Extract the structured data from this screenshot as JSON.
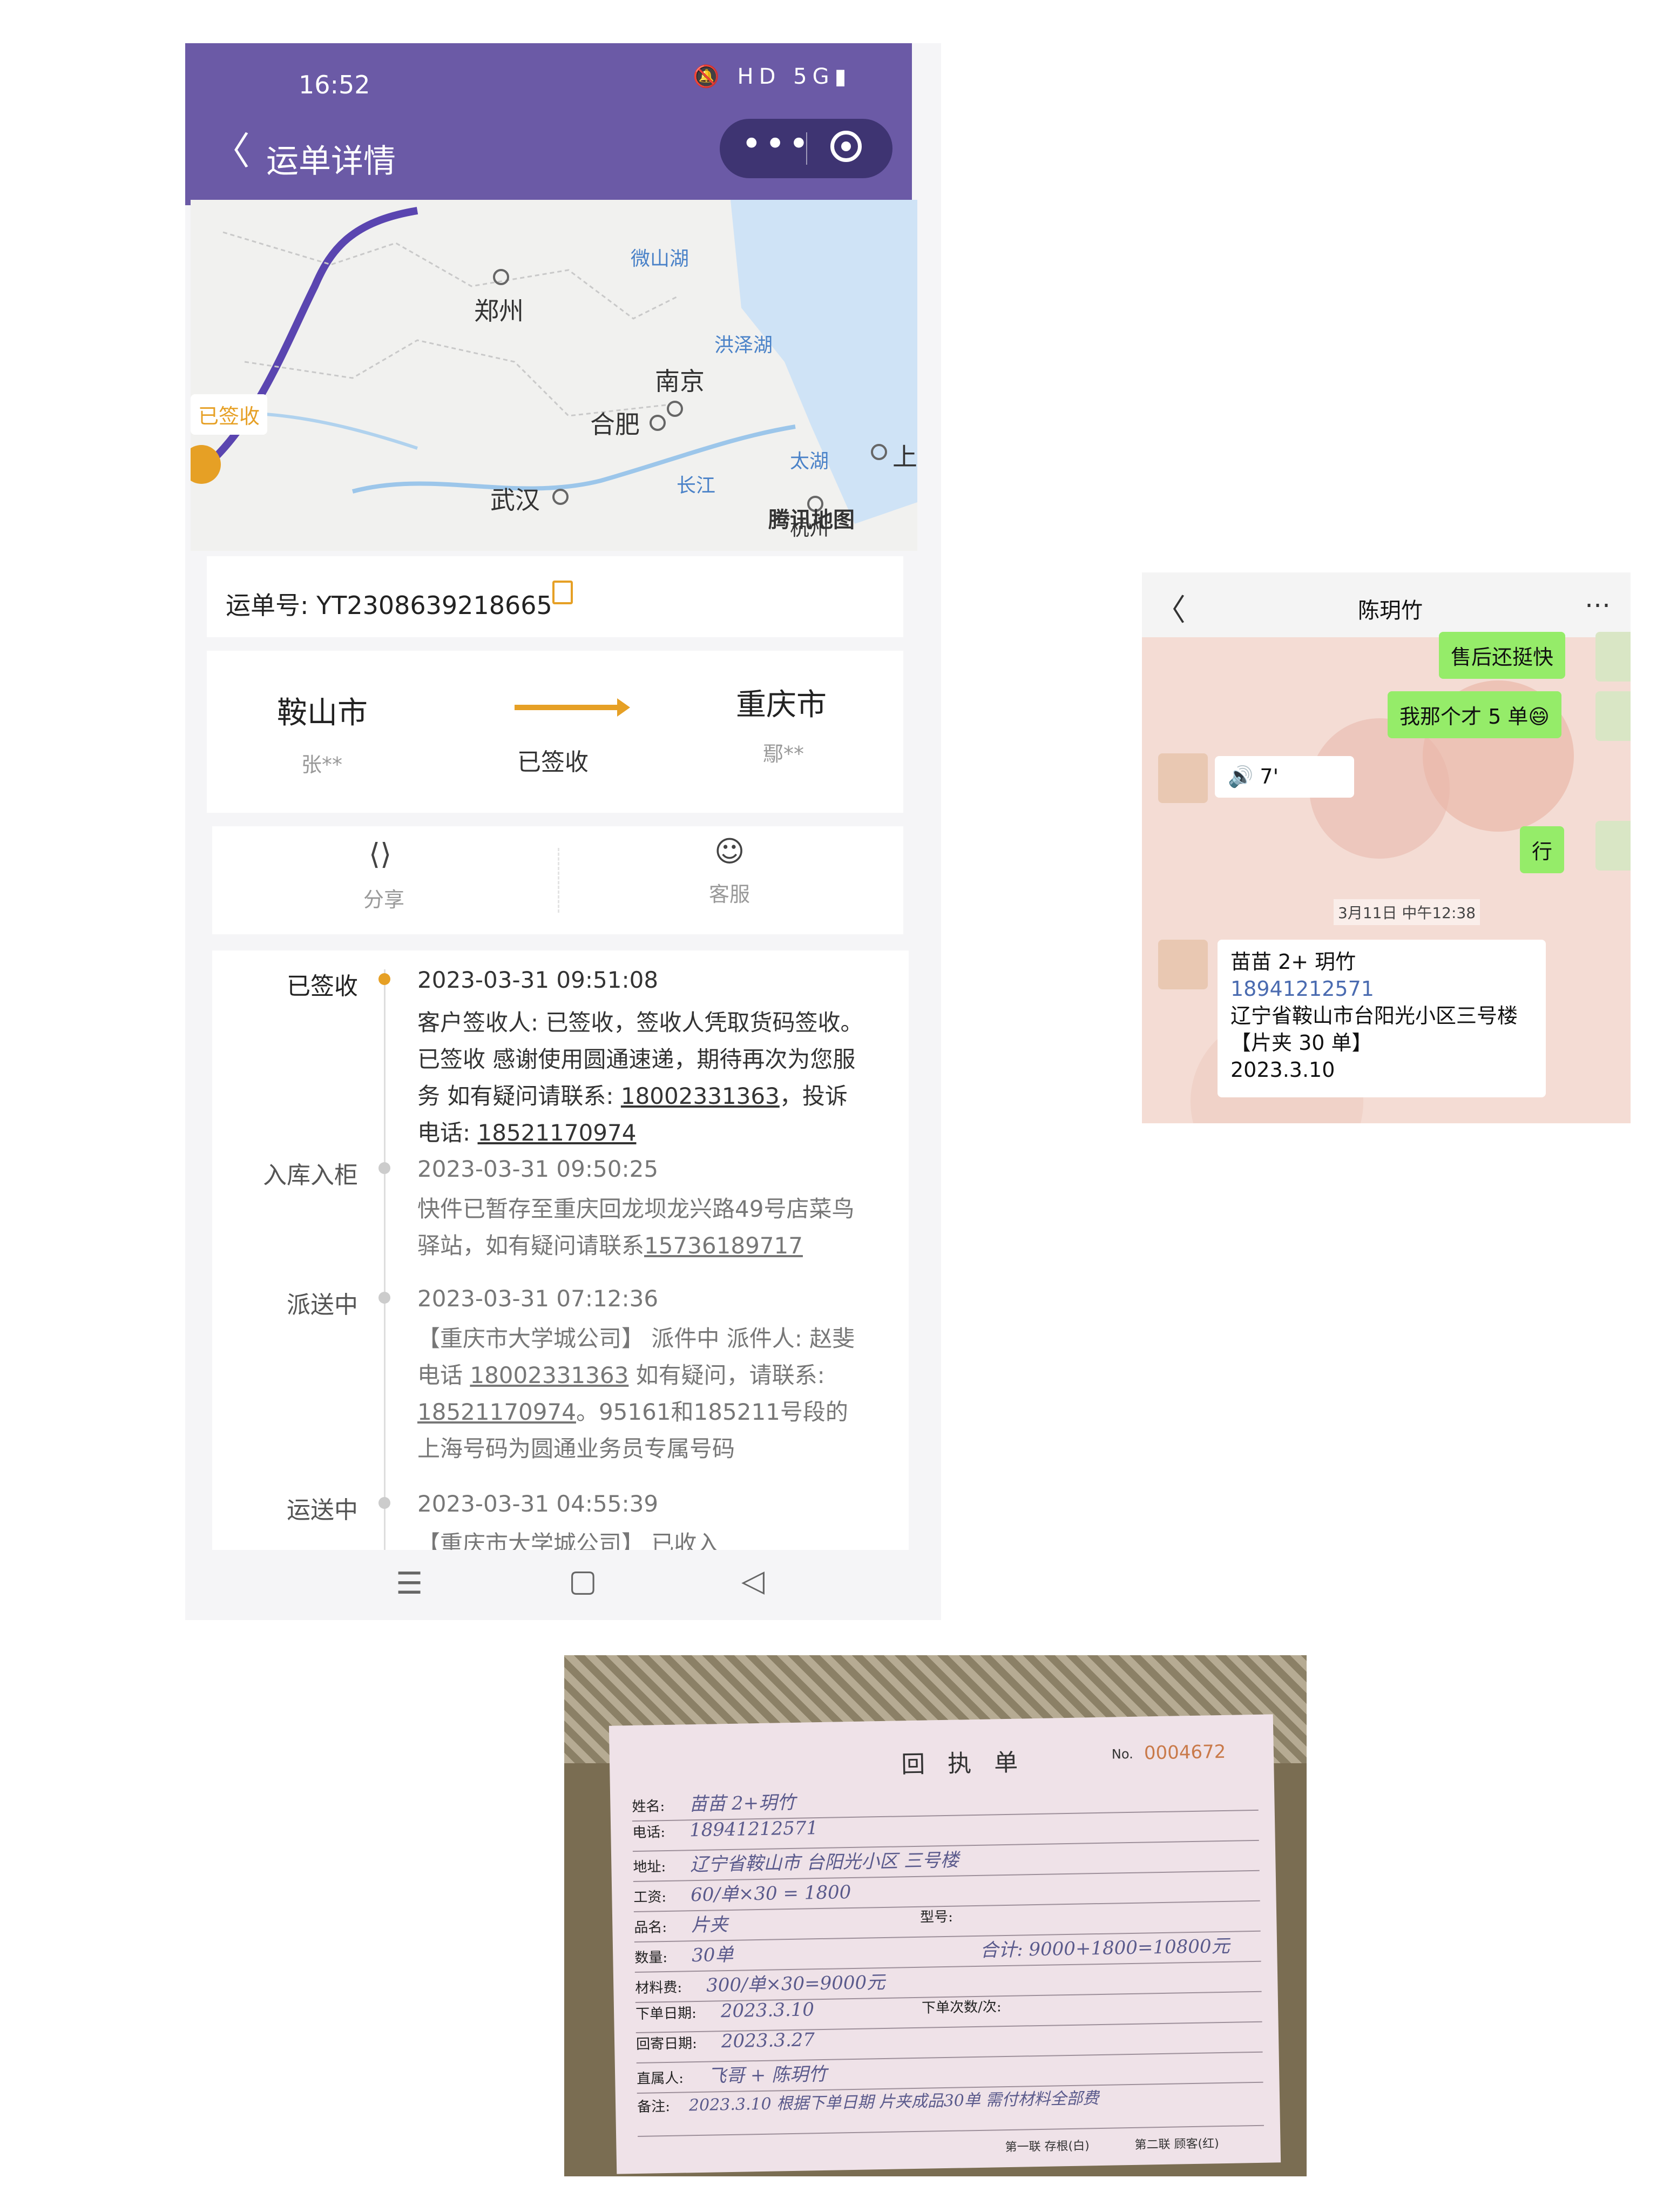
{
  "phone": {
    "status": {
      "time": "16:52",
      "icons": "🔕 HD 5G▮"
    },
    "nav": {
      "back": "〈",
      "title": "运单详情",
      "more": "•••"
    },
    "map": {
      "labels": [
        "郑州",
        "南京",
        "合肥",
        "武汉",
        "杭州",
        "上"
      ],
      "water": [
        "微山湖",
        "洪泽湖",
        "长江",
        "太湖"
      ],
      "brand": "腾讯地图",
      "badge": "已签收"
    },
    "waybill": {
      "label": "运单号: YT2308639218665"
    },
    "route": {
      "from_city": "鞍山市",
      "from_person": "张**",
      "status": "已签收",
      "to_city": "重庆市",
      "to_person": "鄢**"
    },
    "actions": {
      "share": "分享",
      "service": "客服"
    },
    "timeline": [
      {
        "status": "已签收",
        "time": "2023-03-31 09:51:08",
        "text_a": "客户签收人: 已签收，签收人凭取货码签收。 已签收 感谢使用圆通速递，期待再次为您服务 如有疑问请联系: ",
        "phone_a": "18002331363",
        "text_b": "，投诉电话: ",
        "phone_b": "18521170974"
      },
      {
        "status": "入库入柜",
        "time": "2023-03-31 09:50:25",
        "text_a": "快件已暂存至重庆回龙坝龙兴路49号店菜鸟驿站，如有疑问请联系",
        "phone_a": "15736189717"
      },
      {
        "status": "派送中",
        "time": "2023-03-31 07:12:36",
        "text_a": "【重庆市大学城公司】 派件中 派件人: 赵斐 电话 ",
        "phone_a": "18002331363",
        "text_b": " 如有疑问，请联系: ",
        "phone_b": "18521170974",
        "text_c": "。95161和185211号段的上海号码为圆通业务员专属号码"
      },
      {
        "status": "运送中",
        "time": "2023-03-31 04:55:39",
        "text_a": "【重庆市大学城公司】 已收入"
      }
    ],
    "navbar": {
      "menu": "☰",
      "home": "▢",
      "back": "◁"
    }
  },
  "chat": {
    "back": "〈",
    "name": "陈玥竹",
    "more": "…",
    "messages": [
      {
        "side": "right",
        "text": "售后还挺快"
      },
      {
        "side": "right",
        "text": "我那个才 5 单😄"
      },
      {
        "side": "left",
        "text": "🔊 7'"
      },
      {
        "side": "right",
        "text": "行"
      }
    ],
    "time_stamp": "3月11日 中午12:38",
    "card": {
      "line1": "苗苗 2+ 玥竹",
      "line2": "18941212571",
      "line3": "辽宁省鞍山市台阳光小区三号楼",
      "line4": "【片夹 30 单】",
      "line5": "2023.3.10"
    }
  },
  "receipt": {
    "title": "回 执 单",
    "no_label": "No.",
    "no": "0004672",
    "rows": [
      {
        "field": "姓名:",
        "value": "苗苗 2+玥竹"
      },
      {
        "field": "电话:",
        "value": "18941212571"
      },
      {
        "field": "地址:",
        "value": "辽宁省鞍山市 台阳光小区 三号楼"
      },
      {
        "field": "工资:",
        "value": "60/单×30 = 1800"
      },
      {
        "field": "品名:",
        "value": "片夹",
        "extra": "型号:"
      },
      {
        "field": "数量:",
        "value": "30单",
        "extra": "合计: 9000+1800=10800元"
      },
      {
        "field": "材料费:",
        "value": "300/单×30=9000元"
      },
      {
        "field": "下单日期:",
        "value": "2023.3.10",
        "extra": "下单次数/次:"
      },
      {
        "field": "回寄日期:",
        "value": "2023.3.27"
      },
      {
        "field": "直属人:",
        "value": "飞哥 + 陈玥竹"
      },
      {
        "field": "备注:",
        "value": "2023.3.10 根据下单日期 片夹成品30单 需付材料全部费"
      }
    ],
    "footer1": "第一联 存根(白)",
    "footer2": "第二联 顾客(红)"
  }
}
